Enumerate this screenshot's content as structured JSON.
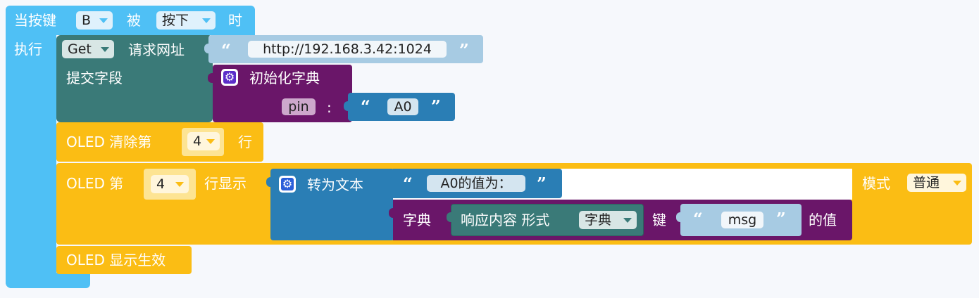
{
  "event": {
    "when_label": "当按键",
    "key_value": "B",
    "is_label": "被",
    "state_value": "按下",
    "then_label": "时",
    "do_label": "执行"
  },
  "http": {
    "method": "Get",
    "request_label": "请求网址",
    "url": "http://192.168.3.42:1024",
    "submit_label": "提交字段"
  },
  "dict_init": {
    "label": "初始化字典",
    "key": "pin",
    "colon": ":",
    "value": "A0"
  },
  "oled_clear": {
    "prefix": "OLED 清除第",
    "row": "4",
    "suffix": "行"
  },
  "oled_show": {
    "prefix": "OLED 第",
    "row": "4",
    "row_suffix": "行显示",
    "to_text_label": "转为文本",
    "text": "A0的值为：",
    "mode_label": "模式",
    "mode_value": "普通"
  },
  "dict_get": {
    "label": "字典",
    "response_label": "响应内容 形式",
    "form_value": "字典",
    "key_label": "键",
    "key": "msg",
    "value_suffix": "的值"
  },
  "oled_apply": {
    "label": "OLED 显示生效"
  },
  "quotes": {
    "open": "“",
    "close": "”"
  },
  "colors": {
    "event_blue": "#4fc0f5",
    "http_teal": "#3a7a78",
    "dict_purple": "#6a1669",
    "text_blue": "#2a7eb5",
    "oled_yellow": "#fbbd14",
    "string_light": "#a7cbe3"
  }
}
